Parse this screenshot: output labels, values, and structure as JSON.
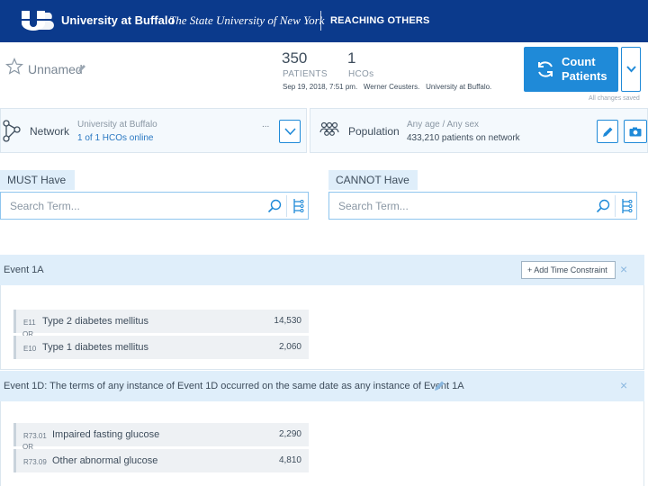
{
  "header": {
    "university": "University at Buffalo",
    "subtitle": "The State University of New York",
    "tagline": "REACHING OTHERS",
    "brand_color": "#0b3a8c"
  },
  "query": {
    "name": "Unnamed",
    "patients_count": "350",
    "patients_label": "PATIENTS",
    "hcos_count": "1",
    "hcos_label": "HCOs",
    "date": "Sep 19, 2018, 7:51 pm.",
    "author": "Werner Ceusters.",
    "institution": "University at Buffalo.",
    "saved_status": "All changes saved"
  },
  "count_button": {
    "label_line1": "Count",
    "label_line2": "Patients",
    "icon": "refresh-icon",
    "color": "#1f8ad8"
  },
  "network": {
    "title": "Network",
    "line1": "University at Buffalo",
    "line2": "1 of 1 HCOs online",
    "more": "...",
    "icon": "network-icon"
  },
  "population": {
    "title": "Population",
    "line1": "Any age / Any sex",
    "line2": "433,210 patients on network",
    "icon": "people-icon"
  },
  "must_have": {
    "label": "MUST Have",
    "placeholder": "Search Term..."
  },
  "cannot_have": {
    "label": "CANNOT Have",
    "placeholder": "Search Term..."
  },
  "events": [
    {
      "title": "Event 1A",
      "add_time_constraint": "+ Add Time Constraint",
      "close": "×",
      "terms": [
        {
          "code": "E11",
          "name": "Type 2 diabetes mellitus",
          "count": "14,530"
        },
        {
          "code": "E10",
          "name": "Type 1 diabetes mellitus",
          "count": "2,060"
        }
      ],
      "connector": "OR"
    },
    {
      "title": "Event 1D: The terms of any instance of Event 1D occurred on the same date as any instance of Event 1A",
      "close": "×",
      "terms": [
        {
          "code": "R73.01",
          "name": "Impaired fasting glucose",
          "count": "2,290"
        },
        {
          "code": "R73.09",
          "name": "Other abnormal glucose",
          "count": "4,810"
        }
      ],
      "connector": "OR"
    }
  ]
}
